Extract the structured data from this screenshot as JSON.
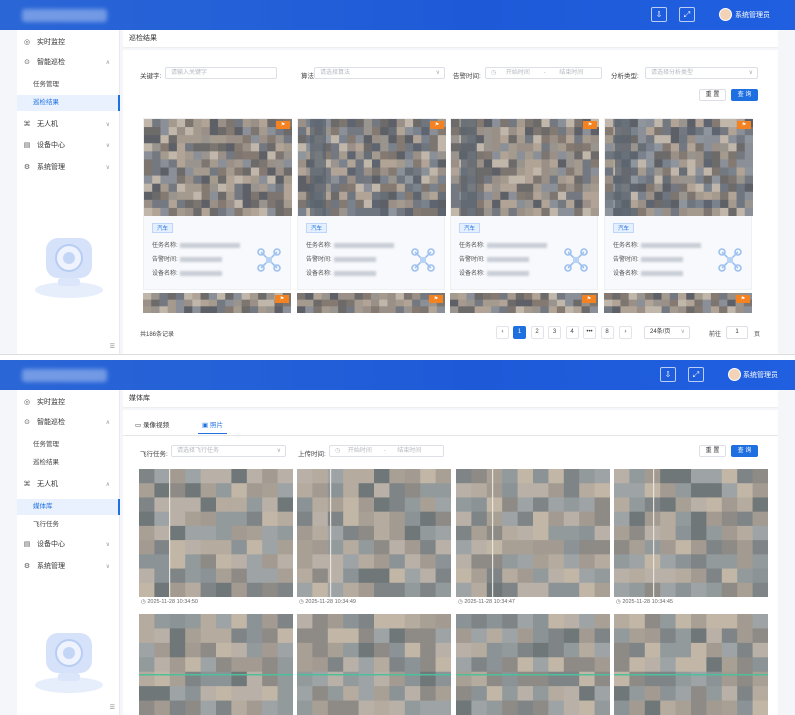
{
  "shot1": {
    "header": {
      "user_name": "系统管理员",
      "icons": [
        "download-icon",
        "expand-icon"
      ]
    },
    "sidebar": {
      "items": [
        {
          "label": "实时监控",
          "icon": "monitor-icon"
        },
        {
          "label": "智能巡检",
          "icon": "inspect-icon",
          "expanded": true
        },
        {
          "label": "任务管理",
          "sub": true
        },
        {
          "label": "巡检结果",
          "sub": true,
          "active": true
        },
        {
          "label": "无人机",
          "icon": "drone-icon"
        },
        {
          "label": "设备中心",
          "icon": "device-icon"
        },
        {
          "label": "系统管理",
          "icon": "settings-icon"
        }
      ]
    },
    "page_title": "巡检结果",
    "filters": {
      "keyword_label": "关键字:",
      "keyword_placeholder": "请输入关键字",
      "algo_label": "算法:",
      "algo_placeholder": "请选择算法",
      "time_label": "告警时间:",
      "time_start": "开始时间",
      "time_sep": "-",
      "time_end": "结束时间",
      "type_label": "分析类型:",
      "type_placeholder": "请选择分析类型",
      "reset": "重 置",
      "query": "查 询"
    },
    "cards": [
      {
        "tag": "汽车",
        "task_label": "任务名称:",
        "time_label": "告警时间:",
        "device_label": "设备名称:"
      },
      {
        "tag": "汽车",
        "task_label": "任务名称:",
        "time_label": "告警时间:",
        "device_label": "设备名称:"
      },
      {
        "tag": "汽车",
        "task_label": "任务名称:",
        "time_label": "告警时间:",
        "device_label": "设备名称:"
      },
      {
        "tag": "汽车",
        "task_label": "任务名称:",
        "time_label": "告警时间:",
        "device_label": "设备名称:"
      }
    ],
    "pagination": {
      "total": "共186条记录",
      "pages": [
        "1",
        "2",
        "3",
        "4",
        "•••",
        "8"
      ],
      "page_size": "24条/页",
      "goto_label": "前往",
      "goto_value": "1",
      "page_suffix": "页"
    }
  },
  "shot2": {
    "header": {
      "user_name": "系统管理员",
      "icons": [
        "download-icon",
        "expand-icon"
      ]
    },
    "sidebar": {
      "items": [
        {
          "label": "实时监控",
          "icon": "monitor-icon"
        },
        {
          "label": "智能巡检",
          "icon": "inspect-icon",
          "expanded": true
        },
        {
          "label": "任务管理",
          "sub": true
        },
        {
          "label": "巡检结果",
          "sub": true
        },
        {
          "label": "无人机",
          "icon": "drone-icon",
          "expanded": true
        },
        {
          "label": "媒体库",
          "sub": true,
          "active": true
        },
        {
          "label": "飞行任务",
          "sub": true
        },
        {
          "label": "设备中心",
          "icon": "device-icon"
        },
        {
          "label": "系统管理",
          "icon": "settings-icon"
        }
      ]
    },
    "page_title": "媒体库",
    "tabs": [
      {
        "label": "录像视频",
        "icon": "video-icon"
      },
      {
        "label": "照片",
        "icon": "photo-icon",
        "active": true
      }
    ],
    "filters": {
      "task_label": "飞行任务:",
      "task_placeholder": "请选择飞行任务",
      "upload_label": "上传时间:",
      "time_start": "开始时间",
      "time_sep": "-",
      "time_end": "结束时间",
      "reset": "重 置",
      "query": "查 询"
    },
    "photos": [
      {
        "time": "2025-11-28 10:34:50"
      },
      {
        "time": "2025-11-28 10:34:49"
      },
      {
        "time": "2025-11-28 10:34:47"
      },
      {
        "time": "2025-11-28 10:34:45"
      }
    ]
  }
}
